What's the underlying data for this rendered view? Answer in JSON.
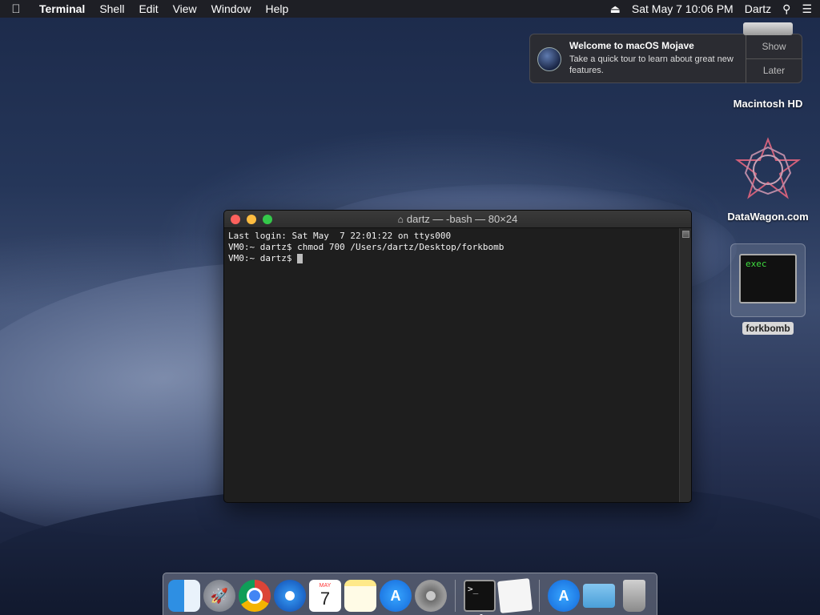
{
  "menubar": {
    "apple_icon": "",
    "items": [
      "Terminal",
      "Shell",
      "Edit",
      "View",
      "Window",
      "Help"
    ],
    "datetime": "Sat May 7  10:06 PM",
    "user": "Dartz"
  },
  "notification": {
    "title": "Welcome to macOS Mojave",
    "body": "Take a quick tour to learn about great new features.",
    "show_label": "Show",
    "later_label": "Later"
  },
  "desktop": {
    "hd_label": "Macintosh HD",
    "datawagon_label": "DataWagon.com",
    "forkbomb_label": "forkbomb",
    "forkbomb_preview": "exec"
  },
  "terminal": {
    "title": "dartz — -bash — 80×24",
    "lines": [
      "Last login: Sat May  7 22:01:22 on ttys000",
      "VM0:~ dartz$ chmod 700 /Users/dartz/Desktop/forkbomb",
      "VM0:~ dartz$ "
    ]
  },
  "dock": {
    "calendar_month": "MAY",
    "calendar_day": "7",
    "terminal_glyph": ">_"
  },
  "colors": {
    "close": "#fc615d",
    "minimize": "#fdbc40",
    "maximize": "#34c84a"
  }
}
